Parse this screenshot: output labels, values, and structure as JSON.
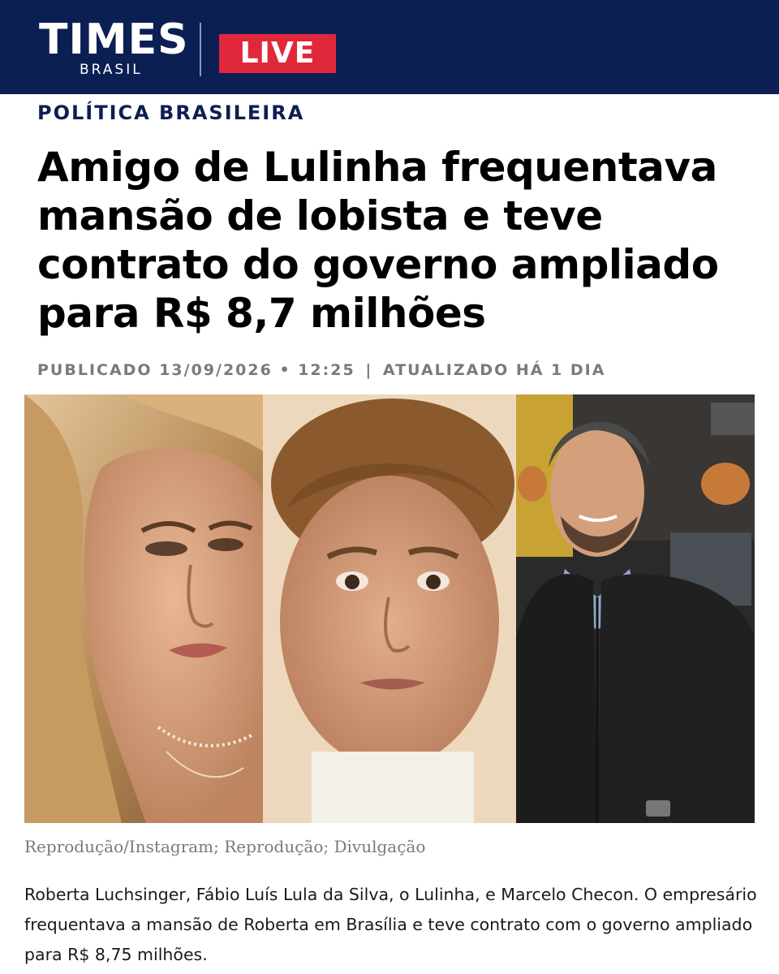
{
  "header": {
    "logo_main": "TIMES",
    "logo_sub": "BRASIL",
    "live_label": "LIVE"
  },
  "article": {
    "section": "POLÍTICA BRASILEIRA",
    "headline": "Amigo de Lulinha frequentava mansão de lobista e teve contrato do governo ampliado para R$ 8,7 milhões",
    "published": "PUBLICADO 13/09/2026 • 12:25",
    "meta_separator": "|",
    "updated": "ATUALIZADO HÁ 1 DIA",
    "photo_credit": "Reprodução/Instagram; Reprodução; Divulgação",
    "caption": "Roberta Luchsinger, Fábio Luís Lula da Silva, o Lulinha, e Marcelo Checon. O empresário frequentava a mansão de Roberta em Brasília e teve contrato com o governo ampliado para R$ 8,75 milhões."
  },
  "colors": {
    "header_bg": "#0c1f52",
    "live_badge": "#e0283a",
    "section_text": "#0c1f52",
    "meta_text": "#7a7a7a"
  }
}
